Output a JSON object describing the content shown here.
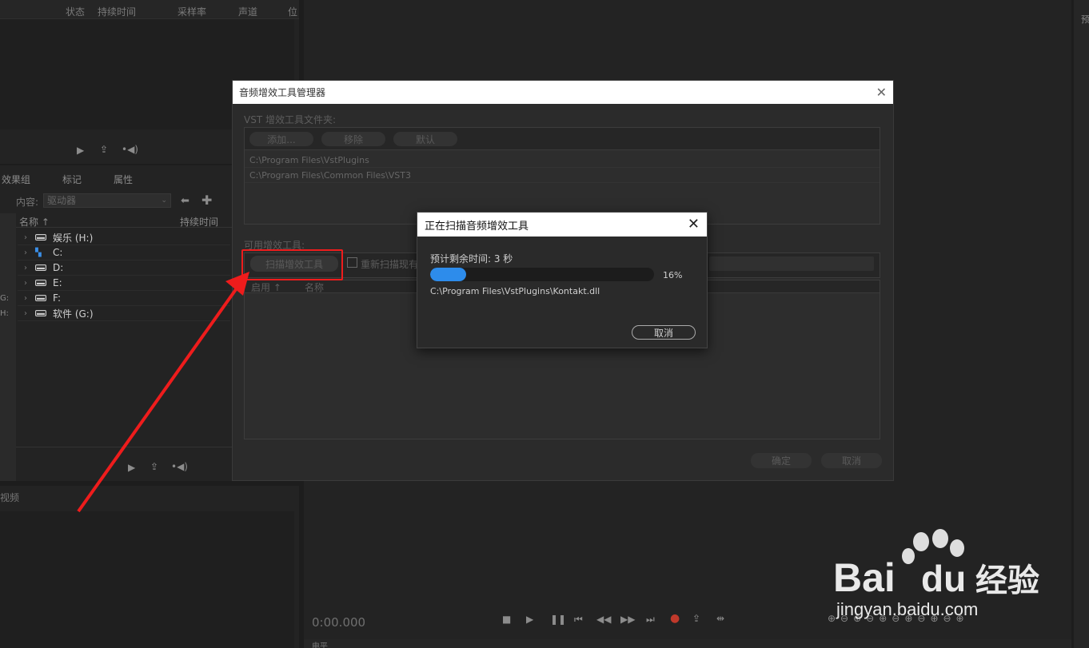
{
  "top_panel": {
    "columns": [
      "状态",
      "持续时间",
      "采样率",
      "声道",
      "位"
    ]
  },
  "browser": {
    "tabs": [
      "效果组",
      "标记",
      "属性"
    ],
    "content_label": "内容:",
    "content_value": "驱动器",
    "col_name": "名称 ↑",
    "col_duration": "持续时间",
    "drives": [
      "娱乐 (H:)",
      "C:",
      "D:",
      "E:",
      "F:",
      "软件 (G:)"
    ],
    "left_edge": [
      "G:",
      "H:"
    ]
  },
  "bottom_left": {
    "label": "视频"
  },
  "right_panel": {
    "label": "预"
  },
  "timecode": "0:00.000",
  "bottom_strip": {
    "label": "电平"
  },
  "manager_dialog": {
    "title": "音频增效工具管理器",
    "vst_folder_label": "VST 增效工具文件夹:",
    "add_label": "添加...",
    "remove_label": "移除",
    "default_label": "默认",
    "paths": [
      "C:\\Program Files\\VstPlugins",
      "C:\\Program Files\\Common Files\\VST3"
    ],
    "available_label": "可用增效工具:",
    "scan_label": "扫描增效工具",
    "rescan_label": "重新扫描现有",
    "col_enabled": "启用 ↑",
    "col_name": "名称",
    "ok_label": "确定",
    "cancel_label": "取消"
  },
  "progress_dialog": {
    "title": "正在扫描音频增效工具",
    "remaining": "预计剩余时间: 3 秒",
    "percent_text": "16%",
    "percent": 0.16,
    "file": "C:\\Program Files\\VstPlugins\\Kontakt.dll",
    "cancel_label": "取消"
  },
  "watermark": {
    "brand": "Bai",
    "brand2": "du",
    "cn": "经验",
    "url": "jingyan.baidu.com"
  },
  "colors": {
    "accent": "#2d8ceb",
    "highlight": "#ee1c1c"
  }
}
